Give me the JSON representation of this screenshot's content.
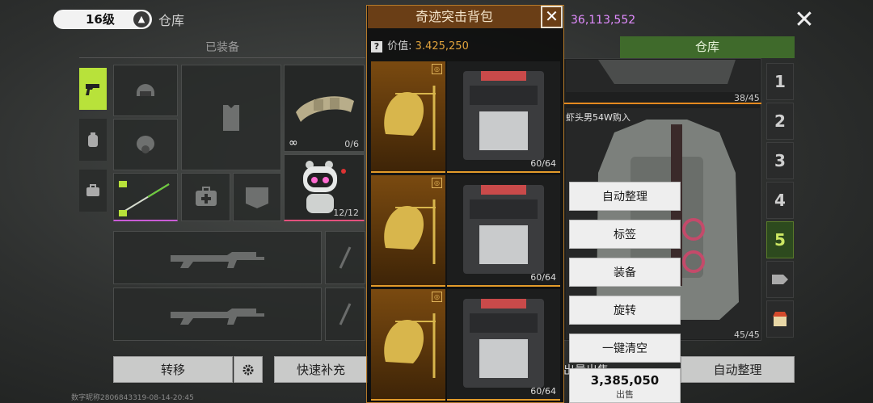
{
  "header": {
    "level": "16级",
    "level_badge": "▲",
    "title": "仓库",
    "currency": "36,113,552",
    "close_icon": "close-icon"
  },
  "tabs": {
    "equipped": "已装备",
    "warehouse": "仓库"
  },
  "left_slots": {
    "belt_count": "0/6",
    "belt_infinite": "∞",
    "robot_count": "12/12"
  },
  "bottom_buttons": {
    "transfer": "转移",
    "quick_refill": "快速补充",
    "auto_sort": "自动整理",
    "bulk_sell_partial": "出量出售"
  },
  "footer": {
    "text": "数字昵称2806843319-08-14-20:45"
  },
  "bag_modal": {
    "title": "奇迹突击背包",
    "value_label": "价值:",
    "value_icon": "?",
    "value_amount": "3.425,250",
    "value_prefix": "3.",
    "value_rest": "425,250",
    "rows": [
      {
        "count": "60/64"
      },
      {
        "count": "60/64"
      },
      {
        "count": "60/64"
      }
    ]
  },
  "right_panel": {
    "top_count": "38/45",
    "vest_label": "虾头男54W购入",
    "vest_count": "45/45",
    "page_tabs": [
      "1",
      "2",
      "3",
      "4",
      "5"
    ],
    "active_page": "5"
  },
  "context_menu": {
    "items": [
      "自动整理",
      "标签",
      "装备",
      "旋转",
      "一键清空"
    ],
    "sell_price": "3,385,050",
    "sell_price_prefix": "3.",
    "sell_price_rest": "385,050",
    "sell_label": "出售"
  },
  "colors": {
    "accent_green": "#b8e23a",
    "warehouse_tab": "#3f6a2b",
    "modal_header": "#6a3e16",
    "price_orange": "#e0a23c",
    "currency_purple": "#e28cff"
  }
}
